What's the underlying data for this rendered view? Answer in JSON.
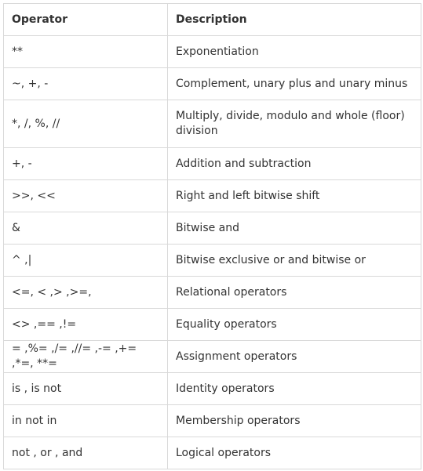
{
  "table": {
    "headers": [
      "Operator",
      "Description"
    ],
    "rows": [
      {
        "operator": "**",
        "description": "Exponentiation"
      },
      {
        "operator": "~, +, -",
        "description": "Complement, unary plus and unary minus"
      },
      {
        "operator": "*, /, %, //",
        "description": "Multiply, divide, modulo and whole (floor) division"
      },
      {
        "operator": "+, -",
        "description": "Addition and subtraction"
      },
      {
        "operator": ">>, <<",
        "description": "Right and left bitwise shift"
      },
      {
        "operator": "&",
        "description": "Bitwise and"
      },
      {
        "operator": "^ ,|",
        "description": "Bitwise exclusive or and bitwise or"
      },
      {
        "operator": "<=, < ,> ,>=,",
        "description": "Relational operators"
      },
      {
        "operator": "<> ,== ,!=",
        "description": "Equality operators"
      },
      {
        "operator": "= ,%= ,/= ,//= ,-= ,+= ,*=, **=",
        "description": "Assignment operators"
      },
      {
        "operator": "is , is not",
        "description": "Identity operators"
      },
      {
        "operator": "in not in",
        "description": "Membership operators"
      },
      {
        "operator": "not , or , and",
        "description": "Logical operators"
      }
    ]
  }
}
